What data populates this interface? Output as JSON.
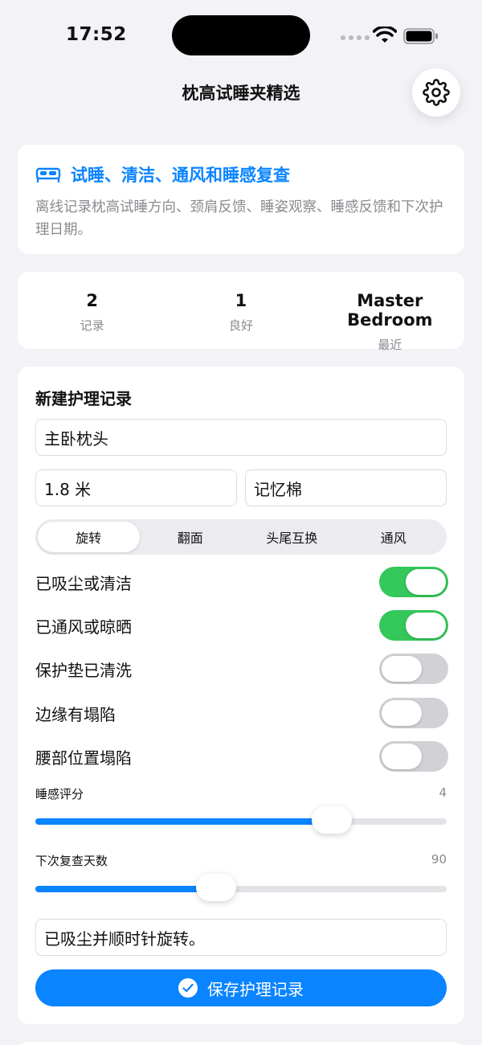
{
  "status": {
    "time": "17:52"
  },
  "nav": {
    "title": "枕高试睡夹精选",
    "settings_icon": "gear-icon"
  },
  "intro": {
    "icon": "bed-icon",
    "title": "试睡、清洁、通风和睡感复查",
    "description": "离线记录枕高试睡方向、颈肩反馈、睡姿观察、睡感反馈和下次护理日期。"
  },
  "stats": [
    {
      "value": "2",
      "label": "记录"
    },
    {
      "value": "1",
      "label": "良好"
    },
    {
      "value": "Master Bedroom",
      "label": "最近"
    }
  ],
  "form": {
    "title": "新建护理记录",
    "name_value": "主卧枕头",
    "size_value": "1.8 米",
    "material_value": "记忆棉",
    "segments": [
      "旋转",
      "翻面",
      "头尾互换",
      "通风"
    ],
    "selected_segment": "旋转",
    "toggles": [
      {
        "label": "已吸尘或清洁",
        "on": true
      },
      {
        "label": "已通风或晾晒",
        "on": true
      },
      {
        "label": "保护垫已清洗",
        "on": false
      },
      {
        "label": "边缘有塌陷",
        "on": false
      },
      {
        "label": "腰部位置塌陷",
        "on": false
      }
    ],
    "sleep_rating": {
      "label": "睡感评分",
      "value": "4",
      "fraction": 0.72
    },
    "next_review": {
      "label": "下次复查天数",
      "value": "90",
      "fraction": 0.44
    },
    "note_value": "已吸尘并顺时针旋转。",
    "save_label": "保存护理记录"
  },
  "colors": {
    "accent": "#0a84ff",
    "toggle_on": "#34c759",
    "toggle_off": "#d1d1d6"
  }
}
